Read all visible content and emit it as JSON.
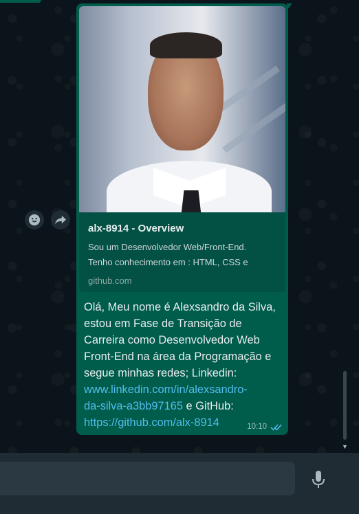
{
  "link_preview": {
    "title": "alx-8914 - Overview",
    "description_line1": "Sou um Desenvolvedor Web/Front-End.",
    "description_line2": "Tenho conhecimento em : HTML, CSS e",
    "host": "github.com"
  },
  "message": {
    "text_before_links": "Olá, Meu nome é Alexsandro da Silva, estou em Fase de Transição de Carreira como Desenvolvedor Web Front-End na área da Programação e segue minhas redes; Linkedin:",
    "linkedin_url_line1": "www.linkedin.com/in/alexsandro-",
    "linkedin_url_line2": "da-silva-a3bb97165",
    "between_links": " e GitHub:",
    "github_url": "https://github.com/alx-8914",
    "time": "10:10",
    "status": "read"
  },
  "icons": {
    "emoji": "smiley-icon",
    "forward": "forward-arrow-icon",
    "mic": "microphone-icon",
    "ticks": "double-check-icon"
  },
  "colors": {
    "outgoing_bubble": "#005c4b",
    "link": "#53bdeb",
    "background": "#0b141a",
    "composer": "#202c33"
  }
}
